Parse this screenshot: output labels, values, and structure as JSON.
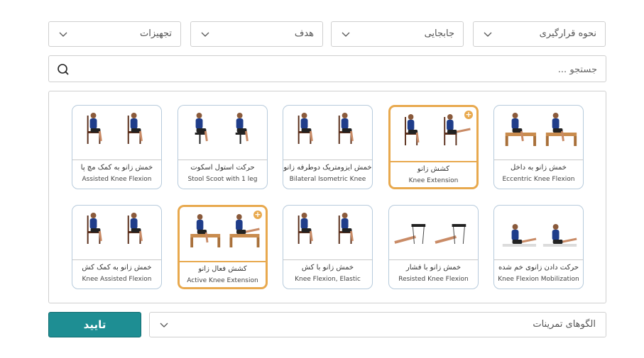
{
  "filters": [
    {
      "label": "نحوه قرارگیری"
    },
    {
      "label": "جابجایی"
    },
    {
      "label": "هدف"
    },
    {
      "label": "تجهیزات"
    }
  ],
  "search": {
    "placeholder": "جستجو ..."
  },
  "exercises": [
    {
      "fa": "خمش زانو به داخل",
      "en": "Eccentric Knee Flexion",
      "selected": false,
      "icon": "table-sit-icon"
    },
    {
      "fa": "کشش زانو",
      "en": "Knee Extension",
      "selected": true,
      "icon": "chair-sit-extend-icon"
    },
    {
      "fa": "خمش  ایزومتریک دوطرفه زانو",
      "en": "Bilateral Isometric Knee",
      "selected": false,
      "icon": "chair-sit-icon"
    },
    {
      "fa": "حرکت استول اسکوت",
      "en": "Stool Scoot with 1 leg",
      "selected": false,
      "icon": "stool-sit-icon"
    },
    {
      "fa": "خمش زانو به کمک مچ پا",
      "en": "Assisted Knee Flexion",
      "selected": false,
      "icon": "chair-sit-icon"
    },
    {
      "fa": "حرکت دادن زانوی خم شده",
      "en": "Knee Flexion Mobilization",
      "selected": false,
      "icon": "floor-sit-icon"
    },
    {
      "fa": "خمش زانو با فشار",
      "en": "Resisted Knee Flexion",
      "selected": false,
      "icon": "leg-only-icon"
    },
    {
      "fa": "خمش زانو با کش",
      "en": "Knee Flexion, Elastic",
      "selected": false,
      "icon": "chair-sit-band-icon"
    },
    {
      "fa": "کشش فعال زانو",
      "en": "Active Knee Extension",
      "selected": true,
      "icon": "table-sit-extend-icon"
    },
    {
      "fa": "خمش زانو به کمک کش",
      "en": "Knee Assisted Flexion",
      "selected": false,
      "icon": "chair-legs-icon"
    }
  ],
  "footer": {
    "confirm_label": "تایید",
    "patterns_label": "الگوهای تمرینات"
  }
}
